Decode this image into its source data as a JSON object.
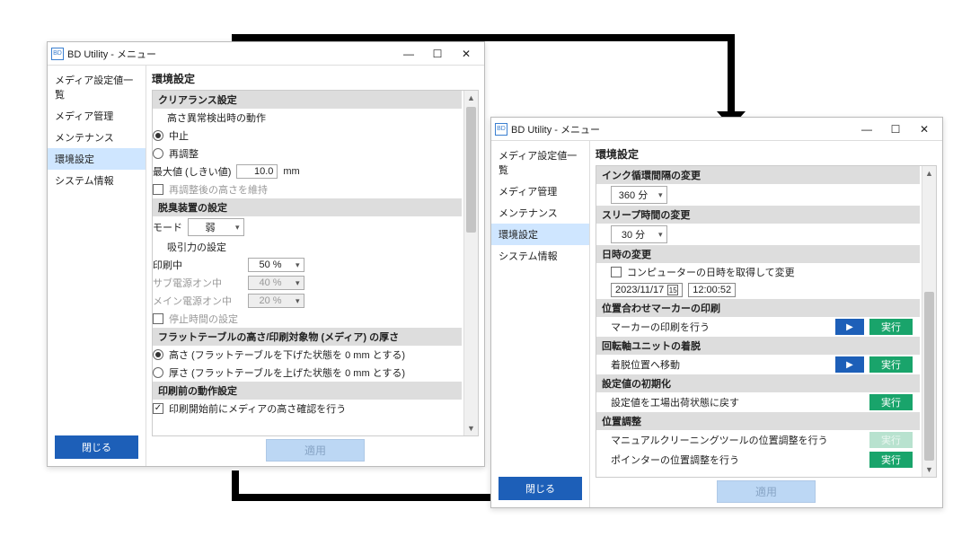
{
  "app_icon": "BD",
  "window_title": "BD Utility - メニュー",
  "win_controls": {
    "min": "—",
    "max": "☐",
    "close": "✕"
  },
  "sidebar": {
    "items": [
      "メディア設定値一覧",
      "メディア管理",
      "メンテナンス",
      "環境設定",
      "システム情報"
    ],
    "close_btn": "閉じる"
  },
  "w1": {
    "title": "環境設定",
    "clearance": {
      "header": "クリアランス設定",
      "sub": "高さ異常検出時の動作",
      "stop": "中止",
      "readjust": "再調整",
      "maxval_label": "最大値 (しきい値)",
      "maxval": "10.0",
      "unit": "mm",
      "keep_height": "再調整後の高さを維持"
    },
    "deodor": {
      "header": "脱臭装置の設定",
      "mode_label": "モード",
      "mode_value": "弱",
      "suction_label": "吸引力の設定",
      "printing": "印刷中",
      "printing_val": "50 %",
      "sub_on": "サブ電源オン中",
      "sub_on_val": "40 %",
      "main_on": "メイン電源オン中",
      "main_on_val": "20 %",
      "stop_time": "停止時間の設定"
    },
    "flat": {
      "header": "フラットテーブルの高さ/印刷対象物 (メディア) の厚さ",
      "opt_height": "高さ (フラットテーブルを下げた状態を 0 mm とする)",
      "opt_thick": "厚さ (フラットテーブルを上げた状態を 0 mm とする)"
    },
    "preprint": {
      "header": "印刷前の動作設定",
      "chk": "印刷開始前にメディアの高さ確認を行う"
    },
    "apply": "適用"
  },
  "w2": {
    "title": "環境設定",
    "ink": {
      "header": "インク循環間隔の変更",
      "value": "360 分"
    },
    "sleep": {
      "header": "スリープ時間の変更",
      "value": "30 分"
    },
    "datetime": {
      "header": "日時の変更",
      "chk": "コンピューターの日時を取得して変更",
      "date": "2023/11/17",
      "time": "12:00:52"
    },
    "marker": {
      "header": "位置合わせマーカーの印刷",
      "label": "マーカーの印刷を行う"
    },
    "rotary": {
      "header": "回転軸ユニットの着脱",
      "label": "着脱位置へ移動"
    },
    "init": {
      "header": "設定値の初期化",
      "label": "設定値を工場出荷状態に戻す"
    },
    "posadj": {
      "header": "位置調整",
      "manual": "マニュアルクリーニングツールの位置調整を行う",
      "pointer": "ポインターの位置調整を行う"
    },
    "apply": "適用",
    "exec": "実行"
  }
}
